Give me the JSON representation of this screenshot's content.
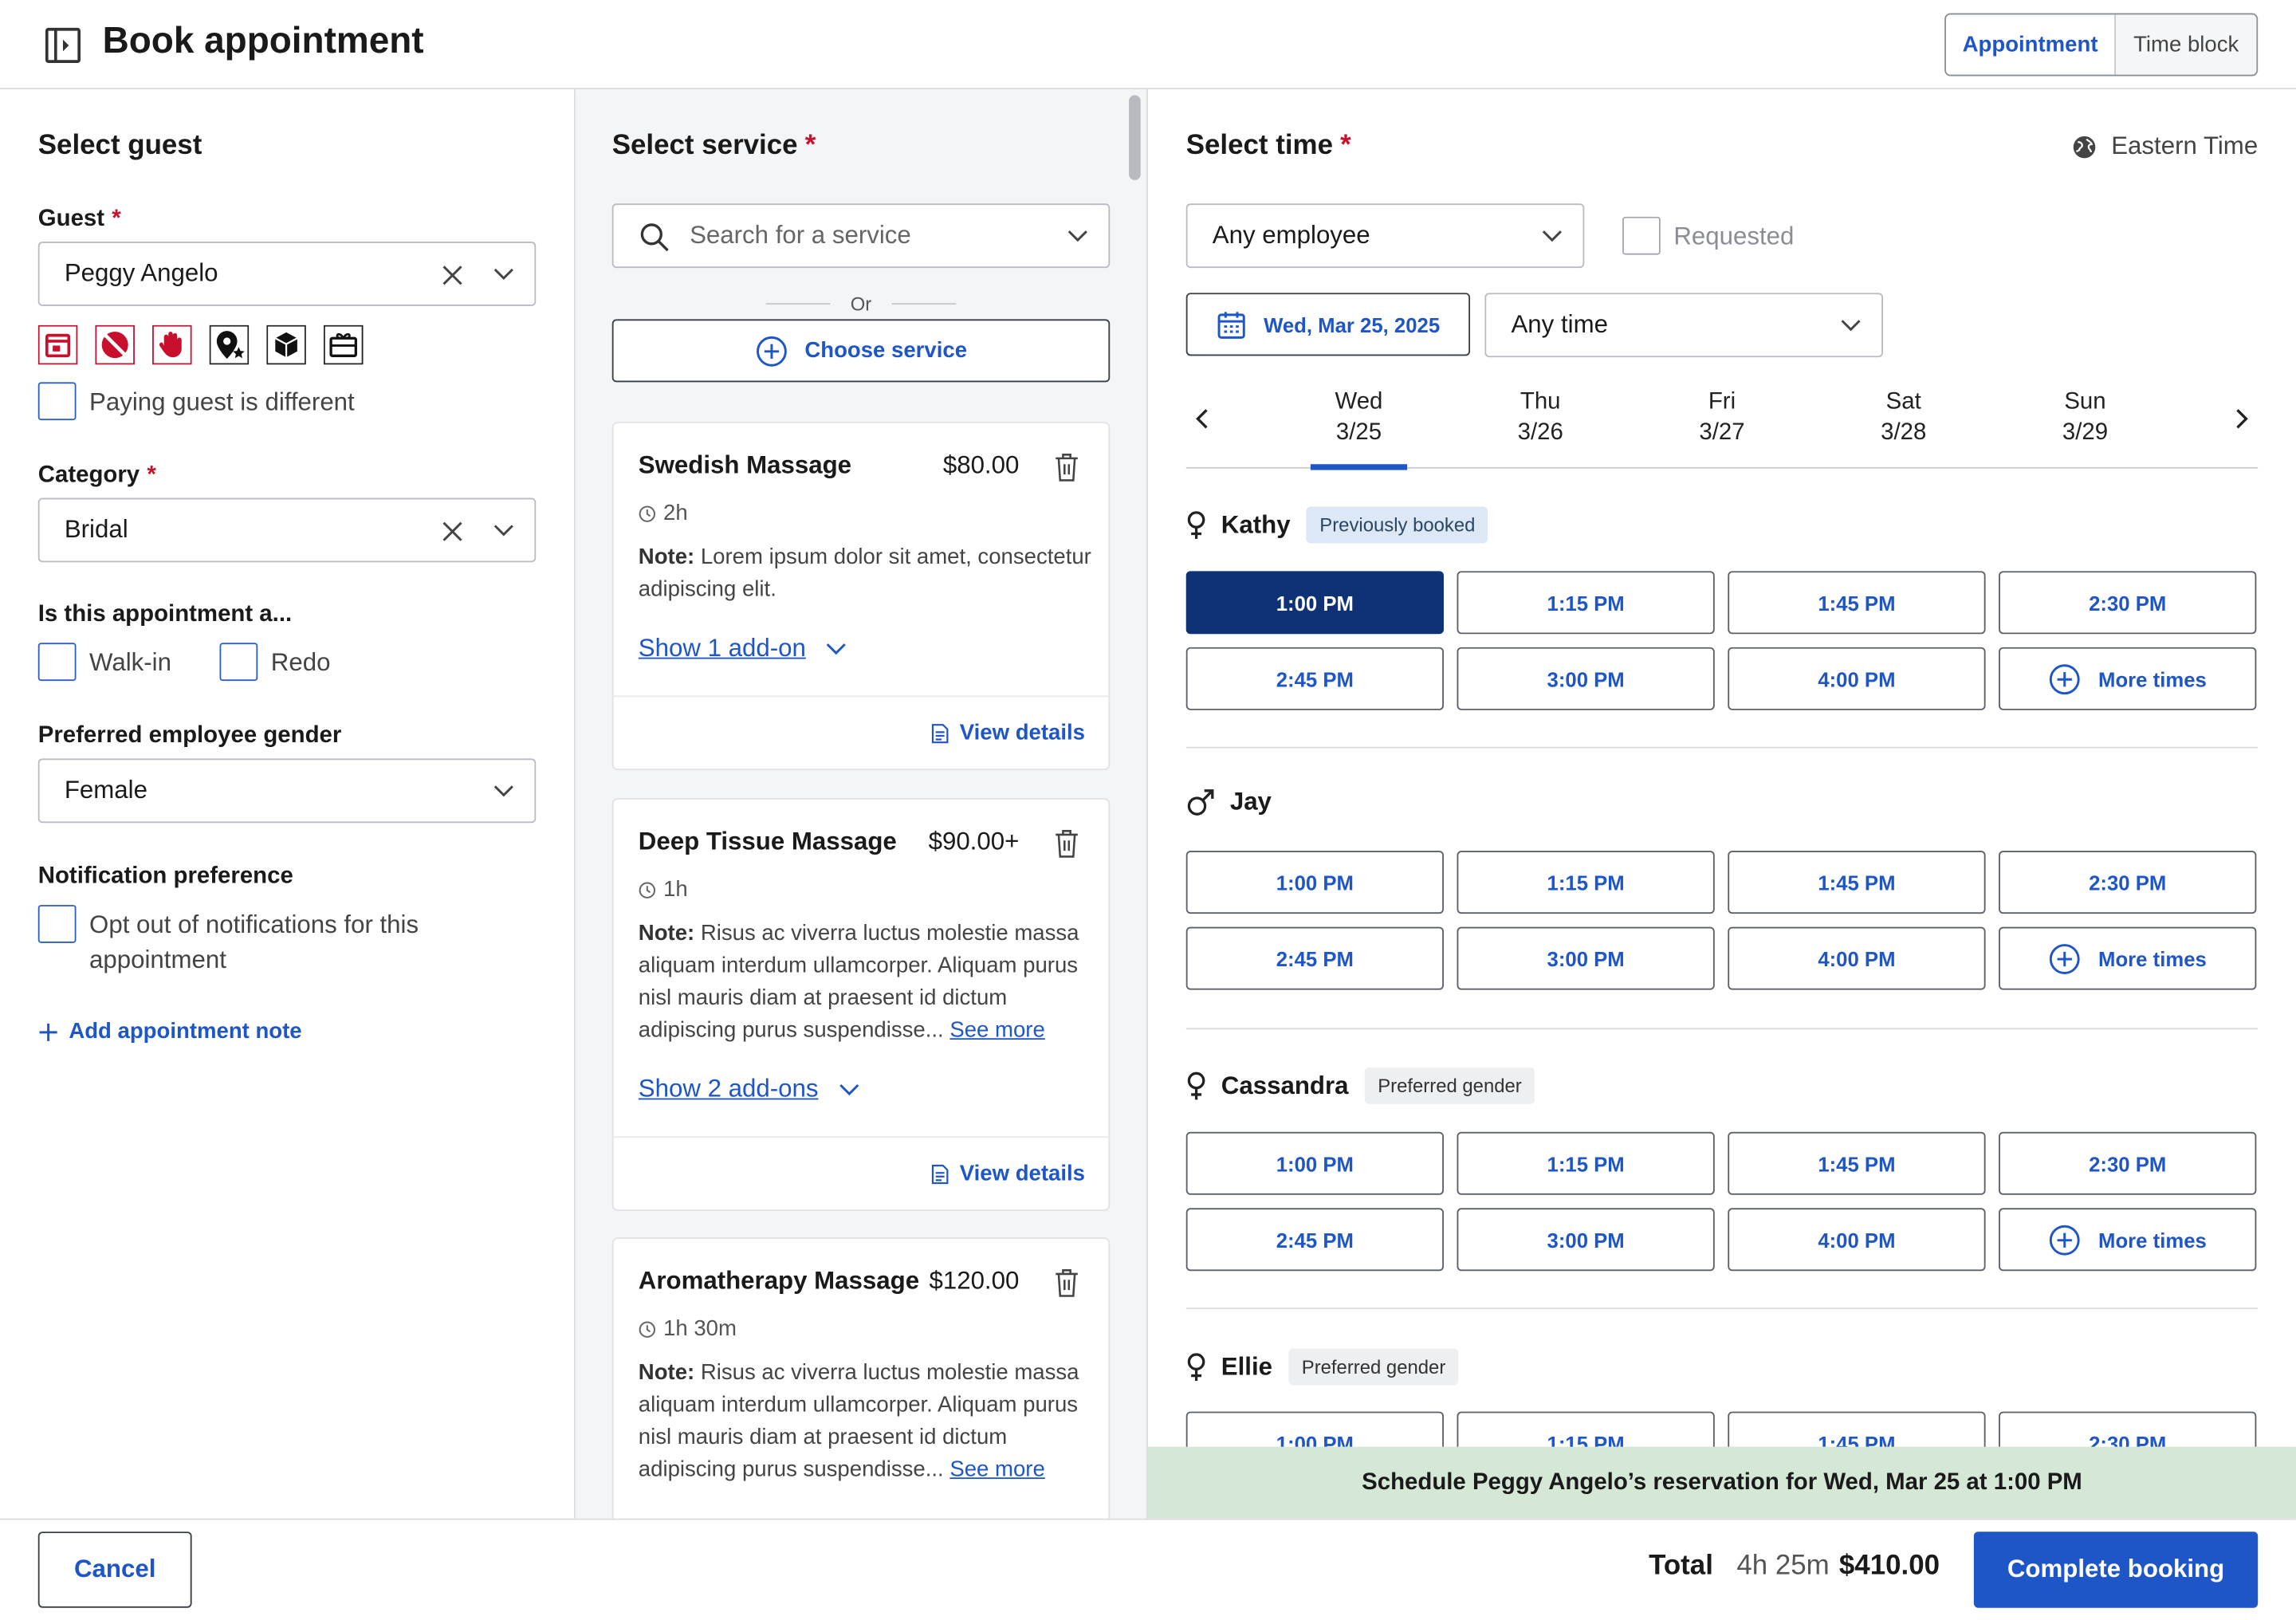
{
  "header": {
    "title": "Book appointment",
    "seg": [
      "Appointment",
      "Time block"
    ]
  },
  "guestPanel": {
    "heading": "Select guest",
    "guestLabel": "Guest",
    "guestValue": "Peggy Angelo",
    "payingLabel": "Paying guest is different",
    "categoryLabel": "Category",
    "categoryValue": "Bridal",
    "apptTypeLabel": "Is this appointment a...",
    "walkIn": "Walk-in",
    "redo": "Redo",
    "genderLabel": "Preferred employee gender",
    "genderValue": "Female",
    "notifLabel": "Notification preference",
    "notifLine1": "Opt out of notifications for this",
    "notifLine2": "appointment",
    "addNote": "Add appointment note",
    "flagIcons": [
      "calendar-flag-icon",
      "no-entry-icon",
      "stop-hand-icon",
      "star-pin-icon",
      "box-icon",
      "gift-card-icon"
    ]
  },
  "servicePanel": {
    "heading": "Select service",
    "searchPlaceholder": "Search for a service",
    "orText": "Or",
    "chooseService": "Choose service",
    "seeMore": "See more",
    "viewDetails": "View details",
    "notePrefix": "Note:",
    "cards": [
      {
        "title": "Swedish Massage",
        "price": "$80.00",
        "duration": "2h",
        "note": "Lorem ipsum dolor sit amet, consectetur adipiscing elit.",
        "addon": "Show 1 add-on"
      },
      {
        "title": "Deep Tissue Massage",
        "price": "$90.00+",
        "duration": "1h",
        "note": "Risus ac viverra luctus molestie massa aliquam interdum ullamcorper. Aliquam purus nisl mauris diam at praesent id dictum adipiscing purus suspendisse...",
        "addon": "Show 2 add-ons"
      },
      {
        "title": "Aromatherapy Massage",
        "price": "$120.00",
        "duration": "1h 30m",
        "note": "Risus ac viverra luctus molestie massa aliquam interdum ullamcorper. Aliquam purus nisl mauris diam at praesent id dictum adipiscing purus suspendisse..."
      }
    ]
  },
  "timePanel": {
    "heading": "Select time",
    "timezone": "Eastern Time",
    "employee": "Any employee",
    "requested": "Requested",
    "date": "Wed, Mar 25, 2025",
    "timeRange": "Any time",
    "days": [
      {
        "day": "Wed",
        "date": "3/25"
      },
      {
        "day": "Thu",
        "date": "3/26"
      },
      {
        "day": "Fri",
        "date": "3/27"
      },
      {
        "day": "Sat",
        "date": "3/28"
      },
      {
        "day": "Sun",
        "date": "3/29"
      }
    ],
    "slotTimes": [
      "1:00 PM",
      "1:15 PM",
      "1:45 PM",
      "2:30 PM",
      "2:45 PM",
      "3:00 PM",
      "4:00 PM"
    ],
    "moreTimes": "More times",
    "employees": [
      {
        "name": "Kathy",
        "badge": "Previously booked",
        "gender": "female"
      },
      {
        "name": "Jay",
        "badge": "",
        "gender": "male"
      },
      {
        "name": "Cassandra",
        "badge": "Preferred gender",
        "gender": "female"
      },
      {
        "name": "Ellie",
        "badge": "Preferred gender",
        "gender": "female"
      }
    ]
  },
  "banner": "Schedule Peggy Angelo’s reservation for Wed, Mar 25 at 1:00 PM",
  "footer": {
    "cancel": "Cancel",
    "totalLabel": "Total",
    "totalDuration": "4h 25m",
    "totalPrice": "$410.00",
    "complete": "Complete booking"
  }
}
